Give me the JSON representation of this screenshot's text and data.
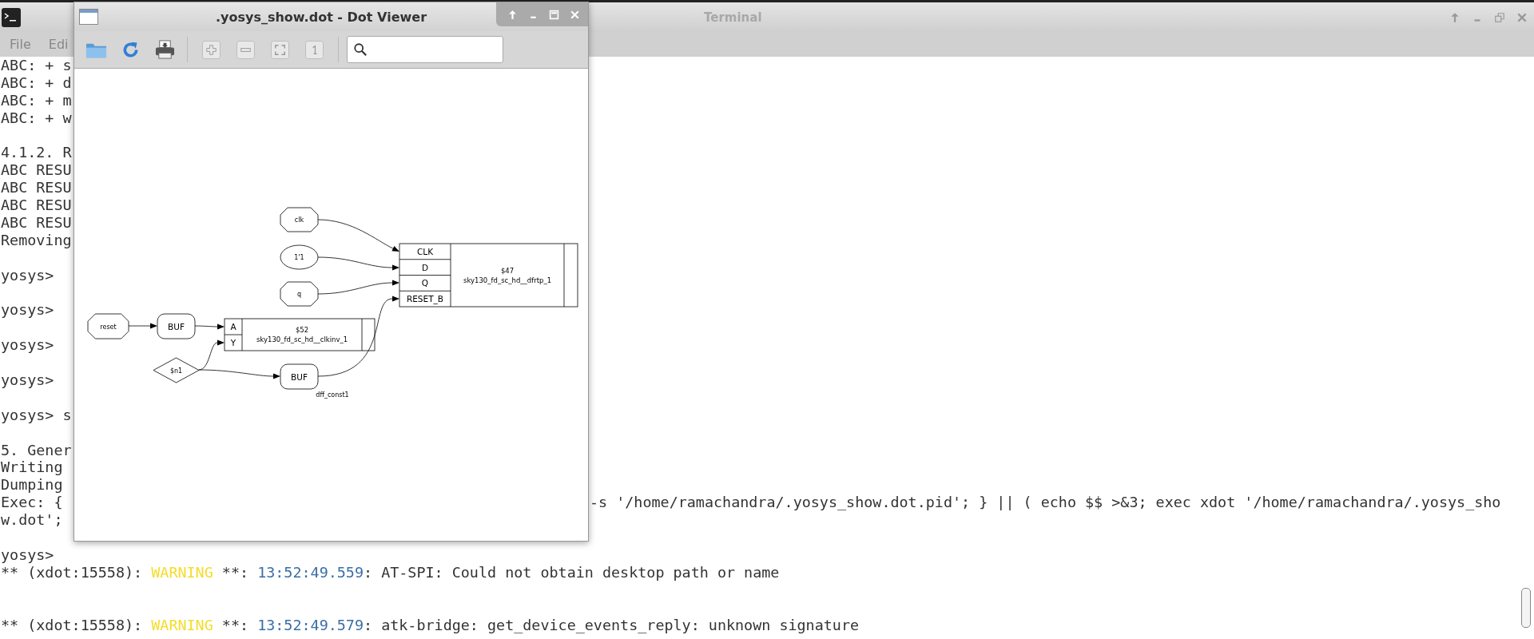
{
  "terminal": {
    "title": "Terminal",
    "menu": [
      "File",
      "Edi"
    ],
    "lines": [
      {
        "kind": "text",
        "text": "ABC: + s"
      },
      {
        "kind": "text",
        "text": "ABC: + d"
      },
      {
        "kind": "text",
        "text": "ABC: + m"
      },
      {
        "kind": "text",
        "text": "ABC: + w"
      },
      {
        "kind": "blank"
      },
      {
        "kind": "text",
        "text": "4.1.2. R"
      },
      {
        "kind": "text",
        "text": "ABC RESU"
      },
      {
        "kind": "text",
        "text": "ABC RESU"
      },
      {
        "kind": "text",
        "text": "ABC RESU"
      },
      {
        "kind": "text",
        "text": "ABC RESU"
      },
      {
        "kind": "text",
        "text": "Removing"
      },
      {
        "kind": "blank"
      },
      {
        "kind": "text",
        "text": "yosys>"
      },
      {
        "kind": "blank"
      },
      {
        "kind": "text",
        "text": "yosys>"
      },
      {
        "kind": "blank"
      },
      {
        "kind": "text",
        "text": "yosys>"
      },
      {
        "kind": "blank"
      },
      {
        "kind": "text",
        "text": "yosys>"
      },
      {
        "kind": "blank"
      },
      {
        "kind": "text",
        "text": "yosys> s"
      },
      {
        "kind": "blank"
      },
      {
        "kind": "text",
        "text": "5. Gener"
      },
      {
        "kind": "text",
        "text": "Writing"
      },
      {
        "kind": "text",
        "text": "Dumping"
      },
      {
        "kind": "split",
        "text": "Exec: {",
        "right": "-s '/home/ramachandra/.yosys_show.dot.pid'; } || ( echo $$ >&3; exec xdot '/home/ramachandra/.yosys_sho"
      },
      {
        "kind": "text",
        "text": "w.dot';"
      },
      {
        "kind": "blank"
      },
      {
        "kind": "text",
        "text": "yosys>"
      },
      {
        "kind": "log",
        "parts": [
          {
            "kind": "plain",
            "text": "** (xdot:15558): "
          },
          {
            "kind": "warning",
            "text": "WARNING"
          },
          {
            "kind": "plain",
            "text": " **: "
          },
          {
            "kind": "time",
            "text": "13:52:49.559"
          },
          {
            "kind": "plain",
            "text": ": AT-SPI: Could not obtain desktop path or name"
          }
        ]
      },
      {
        "kind": "blank"
      },
      {
        "kind": "blank"
      },
      {
        "kind": "log",
        "parts": [
          {
            "kind": "plain",
            "text": "** (xdot:15558): "
          },
          {
            "kind": "warning",
            "text": "WARNING"
          },
          {
            "kind": "plain",
            "text": " **: "
          },
          {
            "kind": "time",
            "text": "13:52:49.579"
          },
          {
            "kind": "plain",
            "text": ": atk-bridge: get_device_events_reply: unknown signature"
          }
        ]
      }
    ]
  },
  "dot_viewer": {
    "title": ".yosys_show.dot - Dot Viewer",
    "nodes": [
      {
        "kind": "port",
        "label": "clk"
      },
      {
        "kind": "const",
        "label": "1'1"
      },
      {
        "kind": "port",
        "label": "q"
      },
      {
        "kind": "cell",
        "name": "$47",
        "type": "sky130_fd_sc_hd__dfrtp_1",
        "ports": [
          "CLK",
          "D",
          "Q",
          "RESET_B"
        ]
      },
      {
        "kind": "port",
        "label": "reset"
      },
      {
        "kind": "buffer",
        "label": "BUF"
      },
      {
        "kind": "cell",
        "name": "$52",
        "type": "sky130_fd_sc_hd__clkinv_1",
        "ports": [
          "A",
          "Y"
        ]
      },
      {
        "kind": "wire",
        "label": "$n1"
      },
      {
        "kind": "buffer",
        "label": "BUF"
      },
      {
        "kind": "label",
        "label": "dff_const1"
      }
    ]
  }
}
